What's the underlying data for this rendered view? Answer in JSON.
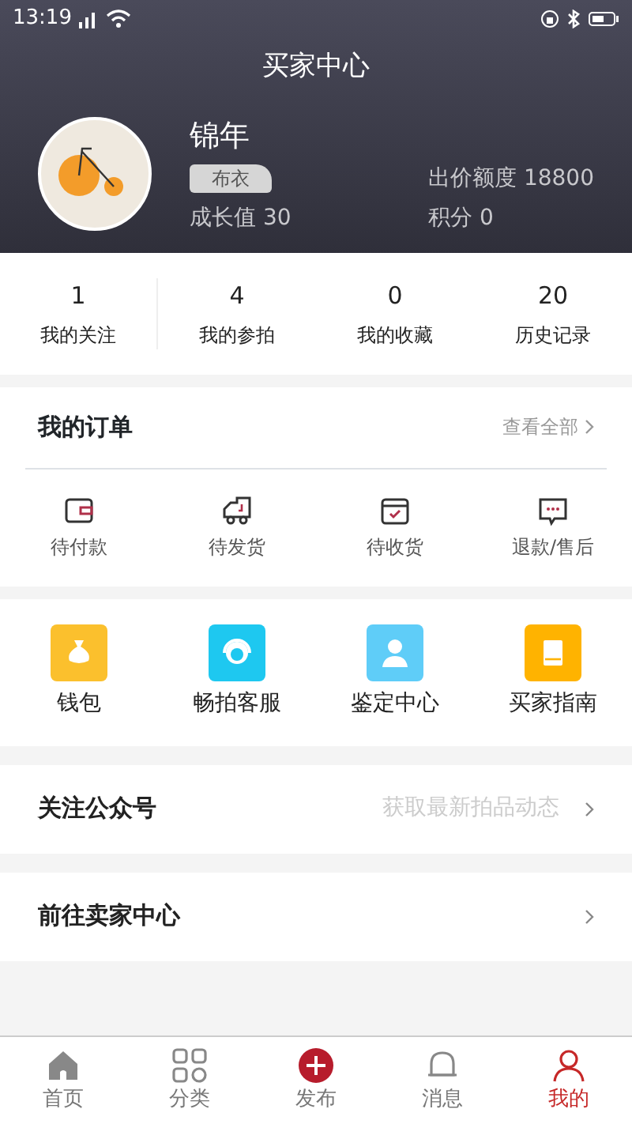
{
  "status_bar": {
    "time": "13:19"
  },
  "header": {
    "title": "买家中心",
    "name": "锦年",
    "badge": "布衣",
    "growth": "成长值 30",
    "bid_limit": "出价额度 18800",
    "points": "积分 0"
  },
  "stats": [
    {
      "value": "1",
      "label": "我的关注"
    },
    {
      "value": "4",
      "label": "我的参拍"
    },
    {
      "value": "0",
      "label": "我的收藏"
    },
    {
      "value": "20",
      "label": "历史记录"
    }
  ],
  "orders": {
    "title": "我的订单",
    "view_all": "查看全部",
    "items": [
      {
        "label": "待付款",
        "kind": "wallet"
      },
      {
        "label": "待发货",
        "kind": "truck"
      },
      {
        "label": "待收货",
        "kind": "box"
      },
      {
        "label": "退款/售后",
        "kind": "chat"
      }
    ]
  },
  "services": [
    {
      "label": "钱包",
      "kind": "bag",
      "color": "#fbc02d"
    },
    {
      "label": "畅拍客服",
      "kind": "headset",
      "color": "#1ec8f0"
    },
    {
      "label": "鉴定中心",
      "kind": "person",
      "color": "#5fcdf8"
    },
    {
      "label": "买家指南",
      "kind": "book",
      "color": "#ffb300"
    }
  ],
  "rows": [
    {
      "label": "关注公众号",
      "hint": "获取最新拍品动态"
    },
    {
      "label": "前往卖家中心"
    }
  ],
  "tabs": [
    {
      "label": "首页",
      "kind": "home",
      "selected": false
    },
    {
      "label": "分类",
      "kind": "grid",
      "selected": false
    },
    {
      "label": "发布",
      "kind": "plus",
      "selected": false
    },
    {
      "label": "消息",
      "kind": "bell",
      "selected": false
    },
    {
      "label": "我的",
      "kind": "user",
      "selected": true
    }
  ]
}
